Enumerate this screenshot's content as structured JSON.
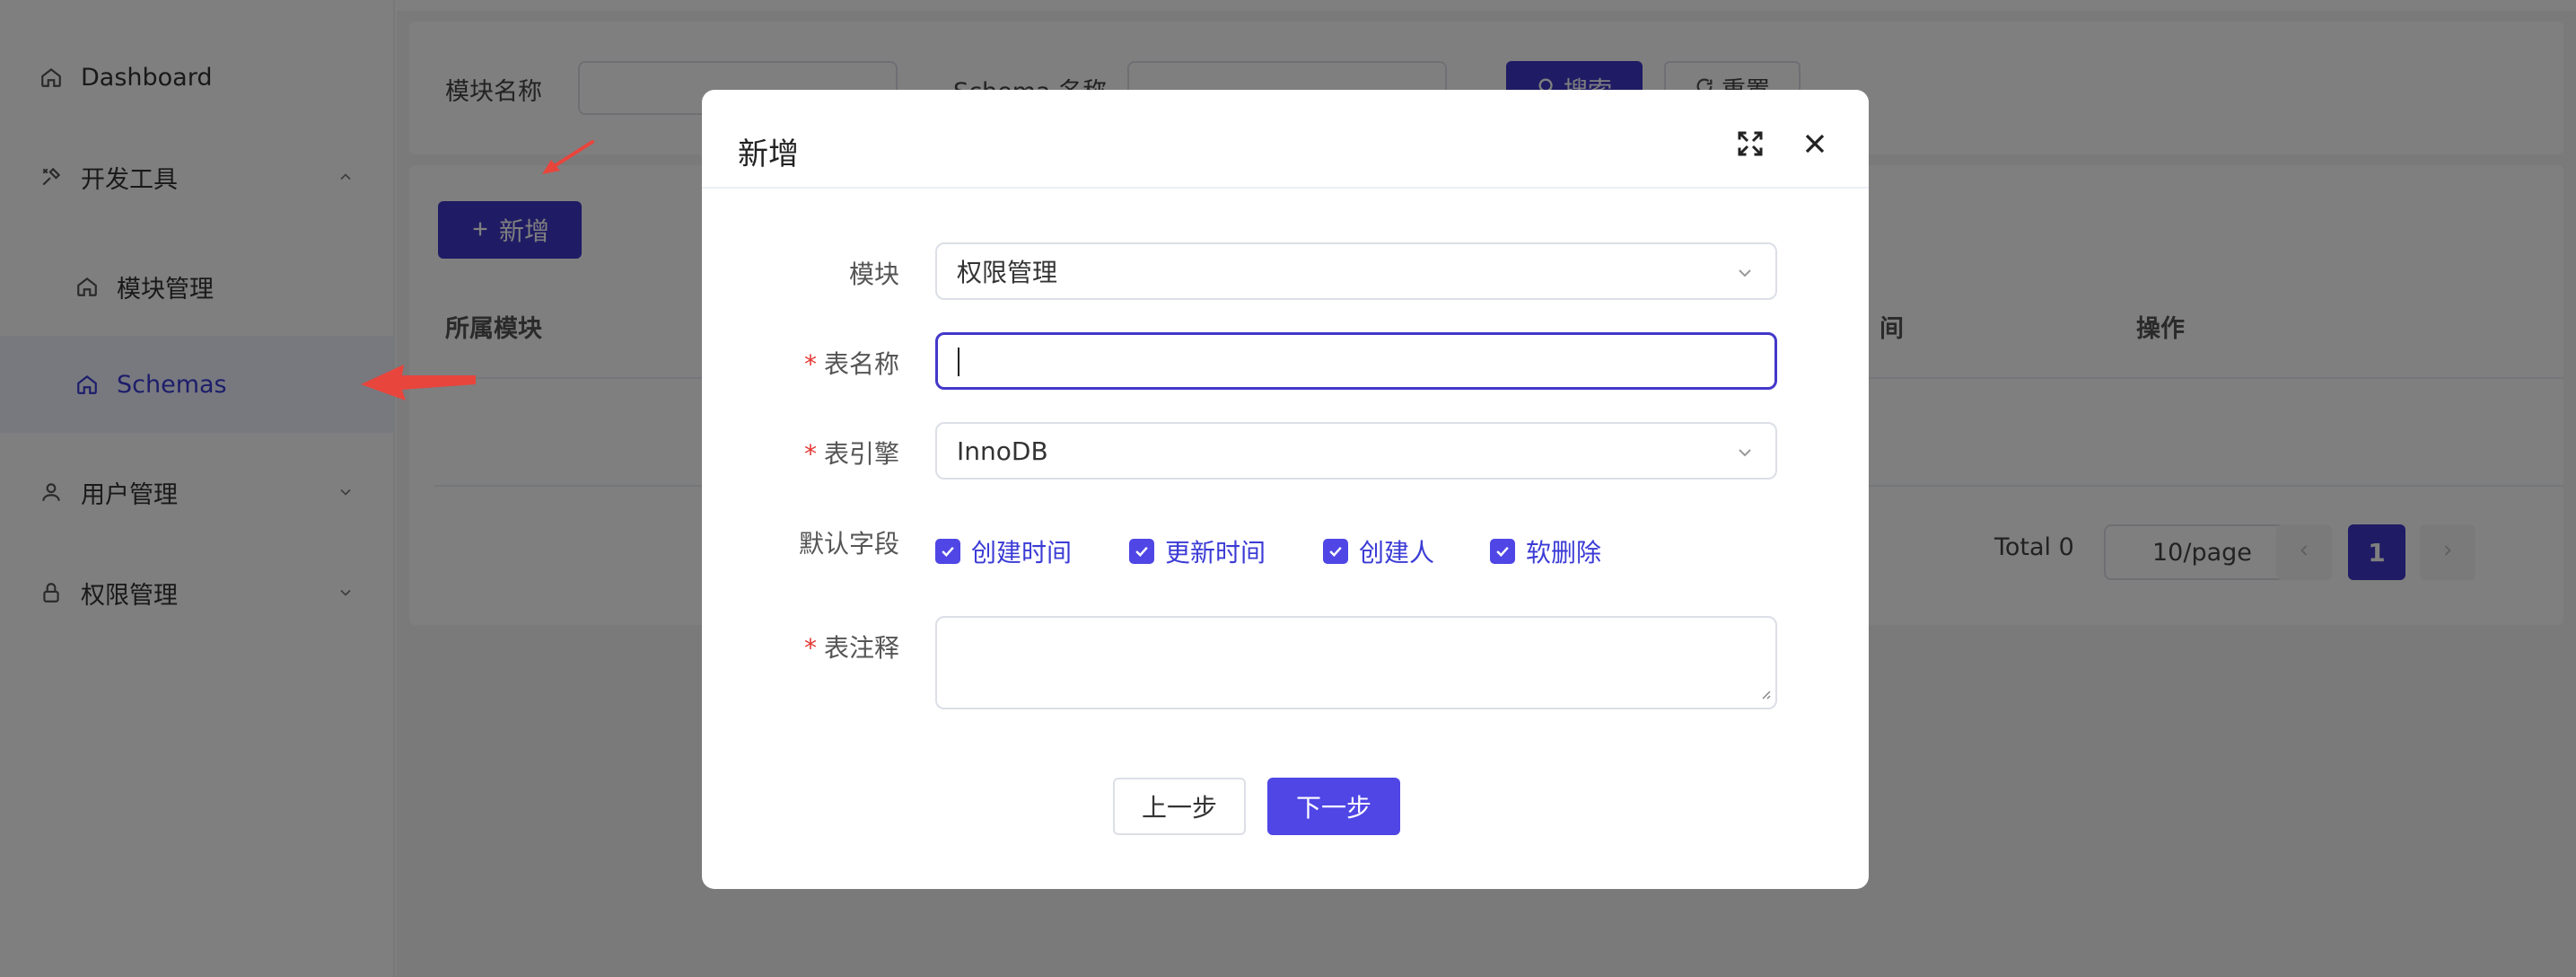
{
  "sidebar": {
    "items": [
      {
        "label": "Dashboard",
        "icon": "home-icon"
      },
      {
        "label": "开发工具",
        "icon": "tools-icon"
      },
      {
        "label": "模块管理",
        "icon": "home-icon"
      },
      {
        "label": "Schemas",
        "icon": "home-icon"
      },
      {
        "label": "用户管理",
        "icon": "user-icon"
      },
      {
        "label": "权限管理",
        "icon": "lock-icon"
      }
    ]
  },
  "search": {
    "module_label": "模块名称",
    "schema_label": "Schema 名称",
    "search_button": "搜索",
    "reset_button": "重置"
  },
  "table": {
    "add_button": "新增",
    "columns": [
      "所属模块",
      "间",
      "操作"
    ],
    "total": "Total 0",
    "page_size": "10/page",
    "current_page": "1"
  },
  "modal": {
    "title": "新增",
    "fields": {
      "module_label": "模块",
      "module_value": "权限管理",
      "table_name_label": "表名称",
      "engine_label": "表引擎",
      "engine_value": "InnoDB",
      "default_fields_label": "默认字段",
      "comment_label": "表注释"
    },
    "checkboxes": [
      "创建时间",
      "更新时间",
      "创建人",
      "软删除"
    ],
    "prev_button": "上一步",
    "next_button": "下一步"
  },
  "colors": {
    "primary": "#3f37c9",
    "accent": "#4f46e5",
    "required": "#e53935",
    "annotation_arrow": "#e8453c"
  }
}
